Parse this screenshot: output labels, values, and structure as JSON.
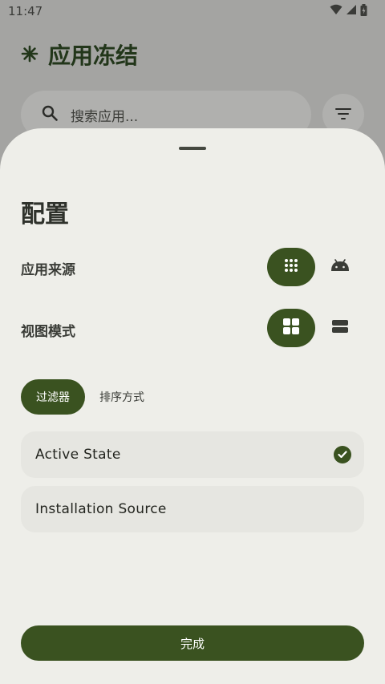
{
  "status_bar": {
    "time": "11:47"
  },
  "app": {
    "title": "应用冻结",
    "search_placeholder": "搜索应用..."
  },
  "sheet": {
    "title": "配置",
    "app_source": {
      "label": "应用来源",
      "selected": "grid"
    },
    "view_mode": {
      "label": "视图模式",
      "selected": "grid"
    },
    "tabs": [
      {
        "label": "过滤器",
        "selected": true
      },
      {
        "label": "排序方式",
        "selected": false
      }
    ],
    "filters": [
      {
        "label": "Active State",
        "checked": true
      },
      {
        "label": "Installation Source",
        "checked": false
      }
    ],
    "done_label": "完成"
  },
  "colors": {
    "accent": "#3a5220",
    "sheet_bg": "#eeeee9",
    "scrim_bg": "#a4a4a2"
  }
}
